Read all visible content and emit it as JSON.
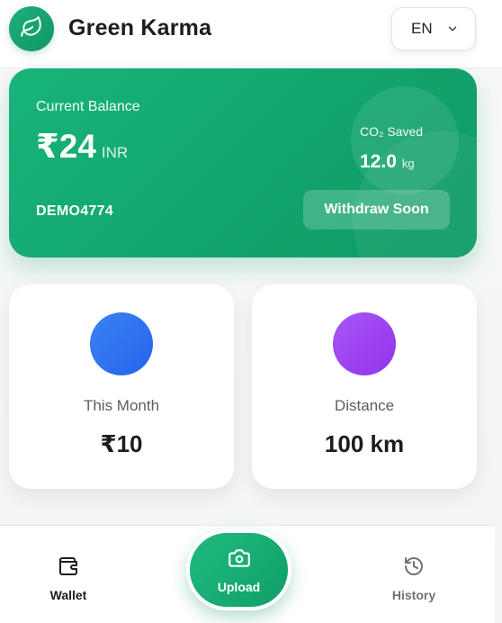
{
  "header": {
    "title": "Green Karma",
    "language": "EN",
    "logo_icon": "leaf-icon"
  },
  "balance": {
    "label": "Current Balance",
    "currency_symbol": "₹",
    "amount": "₹24",
    "unit": "INR",
    "co2_label": "CO₂ Saved",
    "co2_value": "12.0",
    "co2_unit": "kg",
    "user_code": "DEMO4774",
    "withdraw_label": "Withdraw Soon"
  },
  "stats": [
    {
      "label": "This Month",
      "value": "₹10",
      "color": "#3b82f6"
    },
    {
      "label": "Distance",
      "value": "100 km",
      "color": "#a855f7"
    }
  ],
  "nav": {
    "wallet_label": "Wallet",
    "upload_label": "Upload",
    "history_label": "History",
    "active": "Wallet"
  },
  "colors": {
    "primary": "#12a56d",
    "accent_blue": "#3b82f6",
    "accent_purple": "#a855f7"
  }
}
